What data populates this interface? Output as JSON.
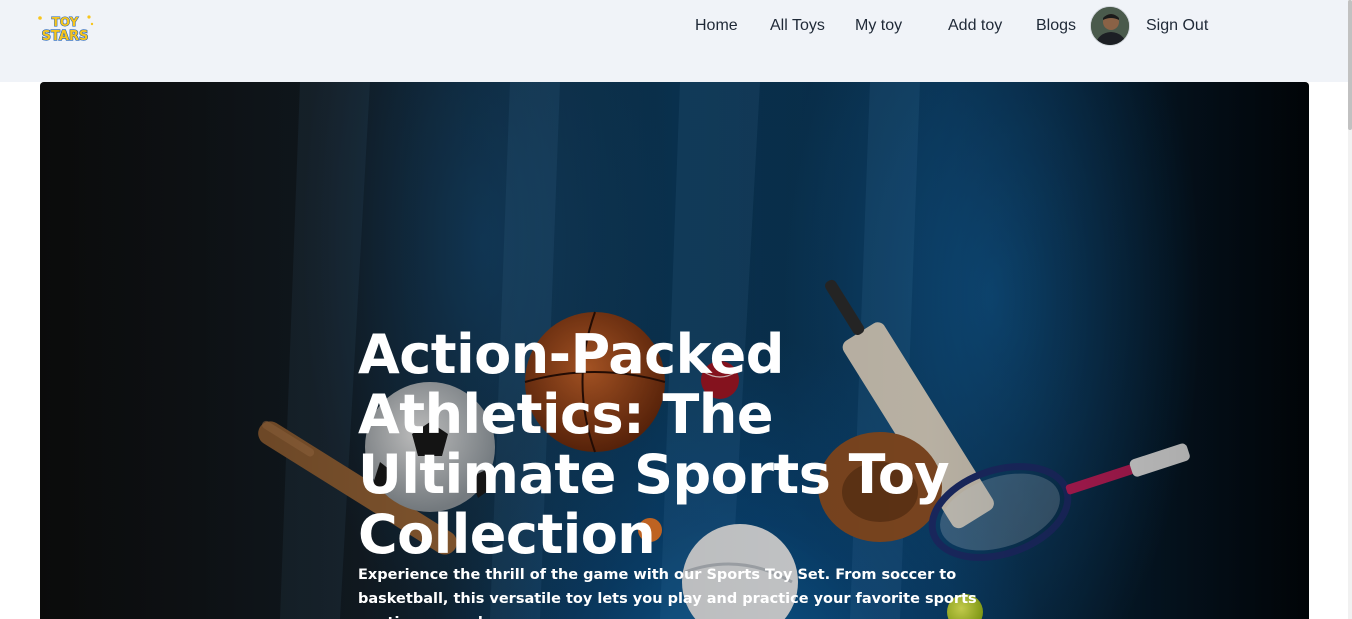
{
  "brand": {
    "logo_top": "TOY",
    "logo_bottom": "STARS",
    "logo_icon": "toy-stars-logo"
  },
  "nav": {
    "links": [
      "Home",
      "All Toys",
      "My toy",
      "Add toy",
      "Blogs"
    ],
    "avatar_icon": "user-avatar",
    "sign_out": "Sign Out"
  },
  "hero": {
    "title": "Action-Packed Athletics: The Ultimate Sports Toy Collection",
    "description": "Experience the thrill of the game with our Sports Toy Set. From soccer to basketball, this versatile toy lets you play and practice your favorite sports anytime, anywhere.",
    "background_icon": "sports-equipment-image"
  },
  "colors": {
    "navbar_bg": "#f0f3f8",
    "nav_text": "#1f2937",
    "hero_text": "#ffffff",
    "logo_yellow": "#f7c51d",
    "logo_blue": "#1d5fb8"
  }
}
